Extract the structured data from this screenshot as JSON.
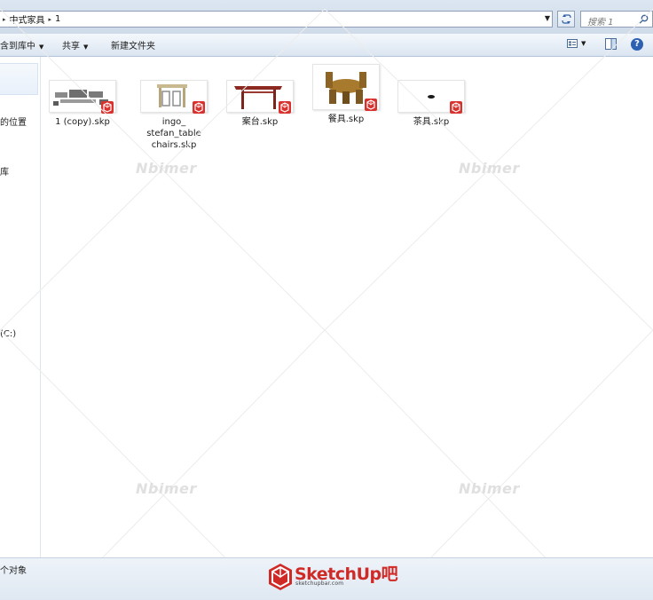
{
  "address_bar": {
    "breadcrumbs": [
      "中式家具",
      "1"
    ],
    "search_placeholder": "搜索 1"
  },
  "toolbar": {
    "include_in_library": "含到库中",
    "share": "共享",
    "new_folder": "新建文件夹"
  },
  "nav_pane": {
    "items": [
      "的位置",
      "库",
      "(C:)"
    ]
  },
  "files": [
    {
      "name": "1 (copy).skp"
    },
    {
      "name": "ingo_\nstefan_table\nchairs.skp"
    },
    {
      "name": "案台.skp"
    },
    {
      "name": "餐具.skp"
    },
    {
      "name": "茶具.skp"
    }
  ],
  "watermarks": [
    "Nbimer",
    "Nbimer",
    "Nbimer",
    "Nbimer"
  ],
  "status_bar": {
    "text": "个对象"
  },
  "logo": {
    "title": "SketchUp吧",
    "subtitle": "sketchupbar.com"
  },
  "colors": {
    "chrome": "#dce6f2",
    "accent": "#2d62b3",
    "logo_red": "#d02a27"
  }
}
